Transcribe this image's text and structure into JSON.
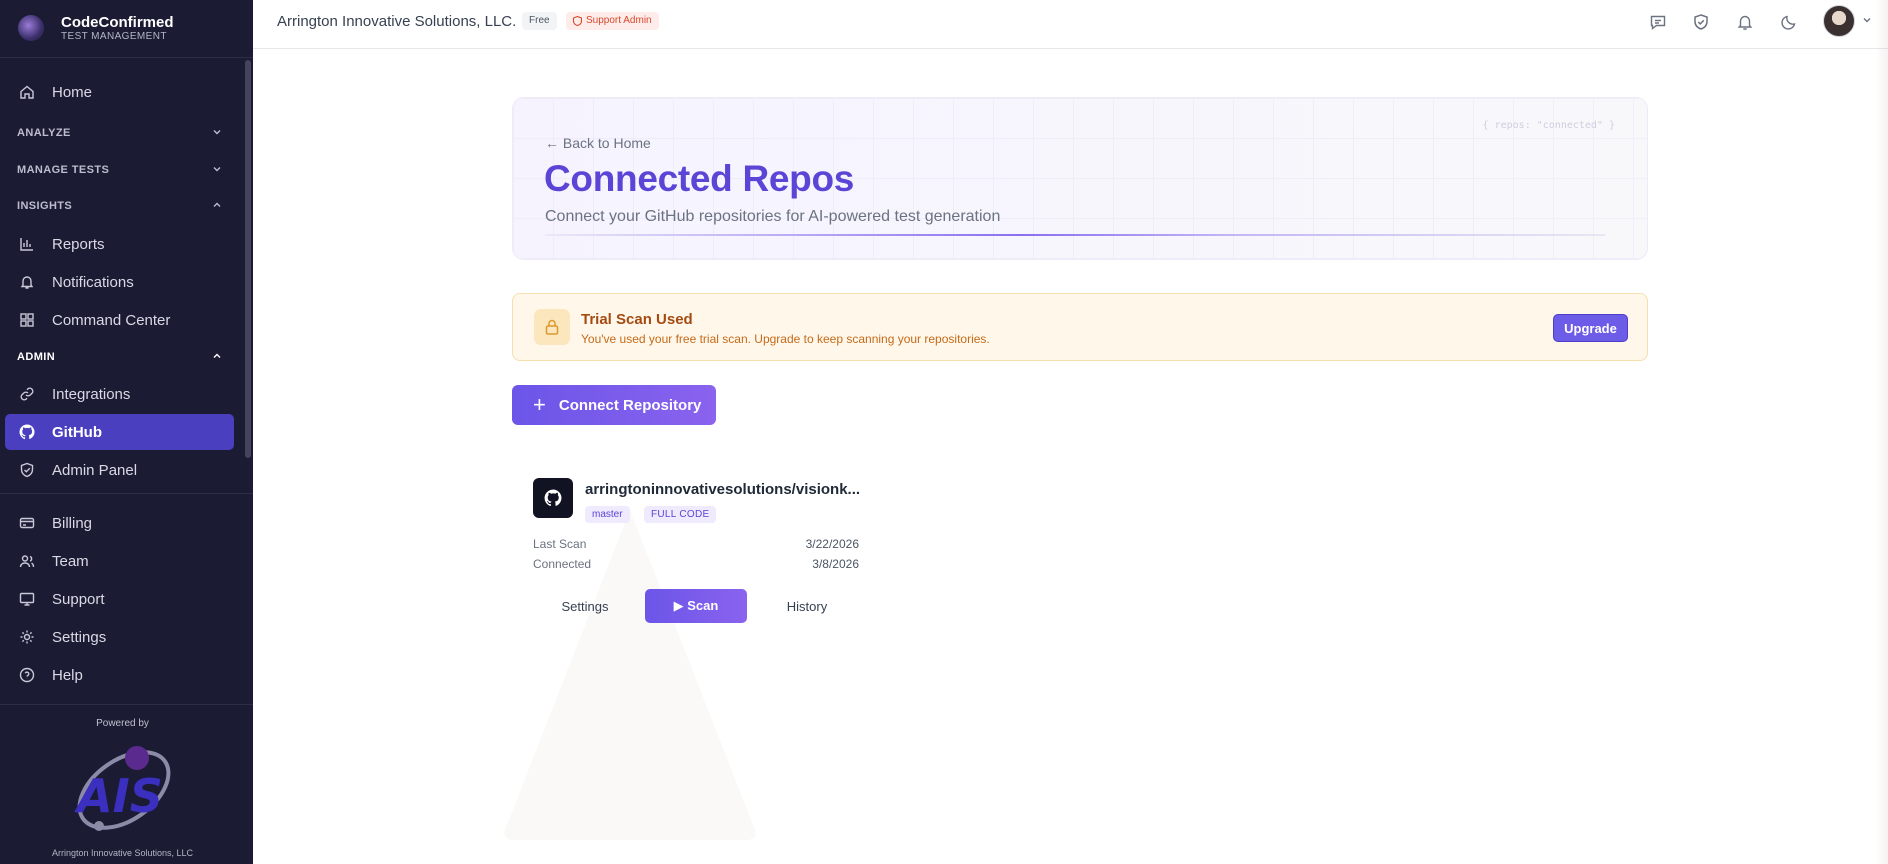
{
  "brand": {
    "name": "CodeConfirmed",
    "subtitle": "TEST MANAGEMENT"
  },
  "sidebar": {
    "home": "Home",
    "sections": {
      "analyze": "ANALYZE",
      "manage_tests": "MANAGE TESTS",
      "insights": "INSIGHTS",
      "admin": "ADMIN"
    },
    "insights_items": [
      "Reports",
      "Notifications",
      "Command Center"
    ],
    "admin_items": [
      "Integrations",
      "GitHub",
      "Admin Panel"
    ],
    "bottom_items": [
      "Billing",
      "Team",
      "Support",
      "Settings",
      "Help"
    ],
    "active_item": "GitHub",
    "powered_by": "Powered by",
    "footer_company": "Arrington Innovative Solutions, LLC",
    "logo_text": "AIS"
  },
  "topbar": {
    "org_name": "Arrington Innovative Solutions, LLC.",
    "plan_badge": "Free",
    "role_badge": "Support Admin",
    "icons": [
      "chat-icon",
      "shield-check-icon",
      "bell-icon",
      "moon-icon"
    ]
  },
  "hero": {
    "back_link": "← Back to Home",
    "title": "Connected Repos",
    "subtitle": "Connect your GitHub repositories for AI-powered test generation",
    "code_watermark": "{ repos: \"connected\" }"
  },
  "trial_banner": {
    "title": "Trial Scan Used",
    "message": "You've used your free trial scan. Upgrade to keep scanning your repositories.",
    "upgrade_label": "Upgrade"
  },
  "connect_button": {
    "label": "Connect Repository"
  },
  "repo": {
    "name": "arringtoninnovativesolutions/visionk...",
    "branch": "master",
    "scan_type": "FULL CODE",
    "last_scan_label": "Last Scan",
    "last_scan_value": "3/22/2026",
    "connected_label": "Connected",
    "connected_value": "3/8/2026",
    "actions": {
      "settings": "Settings",
      "scan": "▶ Scan",
      "history": "History"
    }
  },
  "colors": {
    "sidebar_bg": "#1b1b33",
    "accent": "#6c5ce7",
    "title": "#5b45d6",
    "warning_bg": "#fff8ea"
  }
}
